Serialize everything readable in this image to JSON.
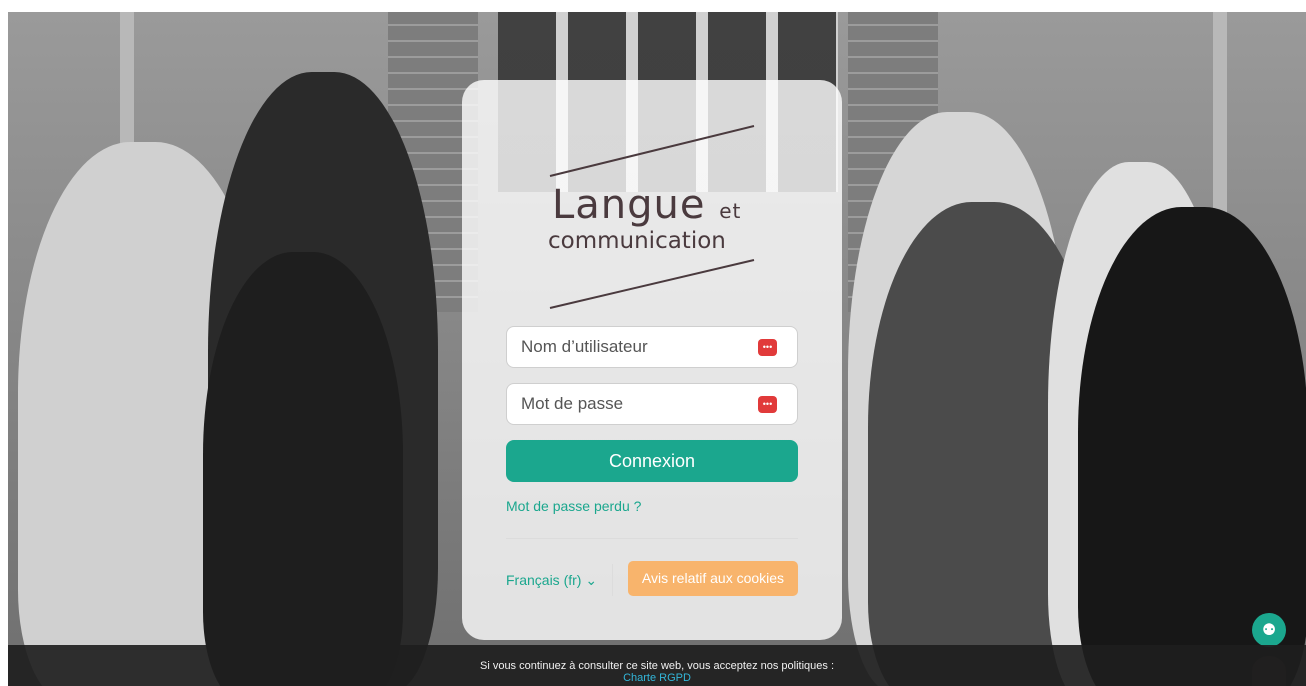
{
  "background": {
    "alt_icon": "group-photo"
  },
  "logo": {
    "line1": "Langue",
    "line1_suffix": "et",
    "line2": "communication"
  },
  "form": {
    "username_placeholder": "Nom d’utilisateur",
    "password_placeholder": "Mot de passe",
    "submit_label": "Connexion",
    "lost_password": "Mot de passe perdu ?"
  },
  "footer_controls": {
    "language": "Français (fr)",
    "language_caret": "⌄",
    "cookies_label": "Avis relatif aux cookies"
  },
  "policy_bar": {
    "message": "Si vous continuez à consulter ce site web, vous acceptez nos politiques :",
    "link": "Charte RGPD"
  },
  "colors": {
    "accent": "#1ba78e",
    "cookie": "#f8b46c",
    "bar": "#1e1e1e"
  }
}
